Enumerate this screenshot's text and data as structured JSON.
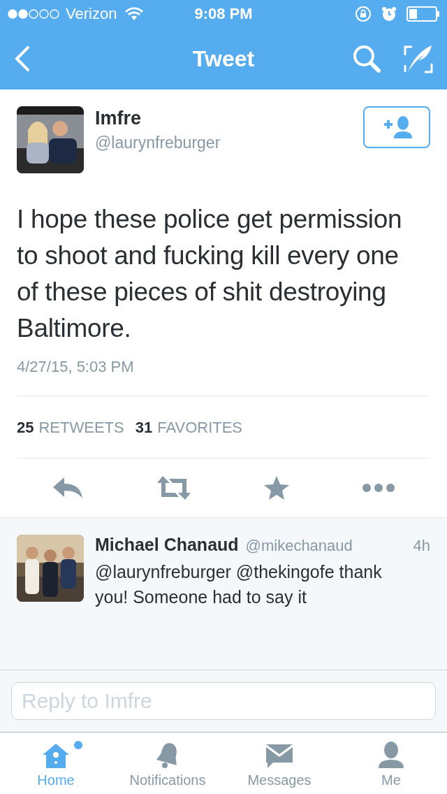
{
  "status_bar": {
    "carrier": "Verizon",
    "time": "9:08 PM"
  },
  "nav": {
    "title": "Tweet"
  },
  "tweet": {
    "name": "Imfre",
    "handle": "@laurynfreburger",
    "text": "I hope these police get permission to shoot and fucking kill every one of these pieces of shit destroying Baltimore.",
    "timestamp": "4/27/15, 5:03 PM",
    "stats": [
      {
        "count": "25",
        "label": "RETWEETS"
      },
      {
        "count": "31",
        "label": "FAVORITES"
      }
    ]
  },
  "replies": [
    {
      "name": "Michael Chanaud",
      "handle": "@mikechanaud",
      "time": "4h",
      "text": "@laurynfreburger @thekingofe thank you! Someone had to say it"
    }
  ],
  "reply_field": {
    "placeholder": "Reply to Imfre"
  },
  "tabs": [
    {
      "kind": "home",
      "label": "Home",
      "selected": true,
      "unread": true
    },
    {
      "kind": "bell",
      "label": "Notifications",
      "selected": false,
      "unread": false
    },
    {
      "kind": "mail",
      "label": "Messages",
      "selected": false,
      "unread": false
    },
    {
      "kind": "person",
      "label": "Me",
      "selected": false,
      "unread": false
    }
  ]
}
